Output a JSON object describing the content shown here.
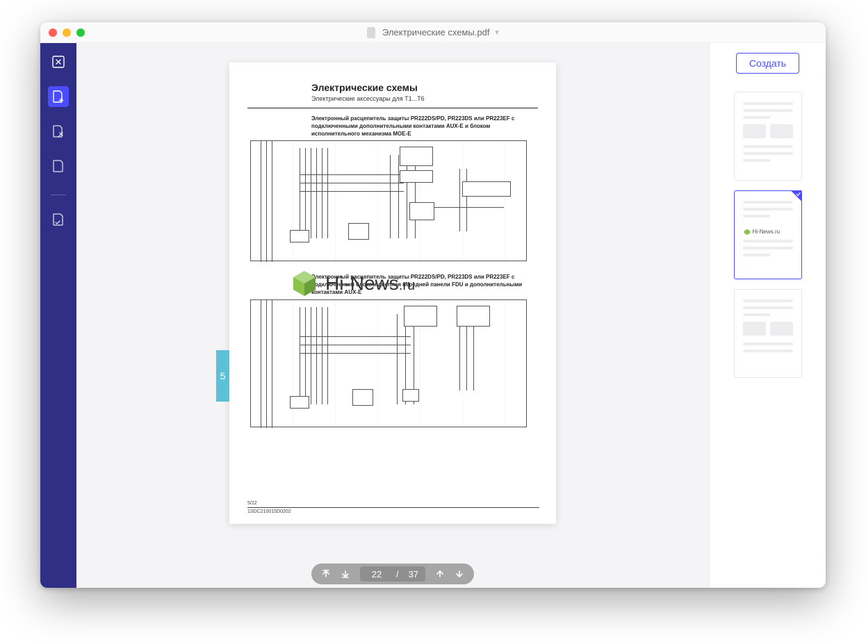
{
  "titlebar": {
    "filename": "Электрические схемы.pdf"
  },
  "sidebar": {
    "items": [
      {
        "name": "close-tool"
      },
      {
        "name": "add-page-tool"
      },
      {
        "name": "edit-page-tool"
      },
      {
        "name": "blank-page-tool"
      },
      {
        "name": "form-tool"
      }
    ]
  },
  "pager": {
    "current": "22",
    "separator": "/",
    "total": "37"
  },
  "rightpanel": {
    "create_label": "Создать"
  },
  "document": {
    "page_tab": "5",
    "title": "Электрические схемы",
    "subtitle": "Электрические аксессуары для T1...T6",
    "section1": "Электронный расцепитель защиты PR222DS/PD, PR223DS или PR223EF с подключенными дополнительными контактами AUX-E и блоком исполнительного механизма MOE-E",
    "section2": "Электронный расцепитель защиты PR222DS/PD, PR223DS или PR223EF с подключенным блоком дисплея передней панели FDU и дополнительными контактами AUX-E",
    "footer_page": "5/22",
    "footer_code": "1SDC210015D0202",
    "watermark_text": "Hi-News",
    "watermark_suffix": ".ru"
  },
  "thumbs": {
    "watermark": "Hi-News.ru"
  }
}
